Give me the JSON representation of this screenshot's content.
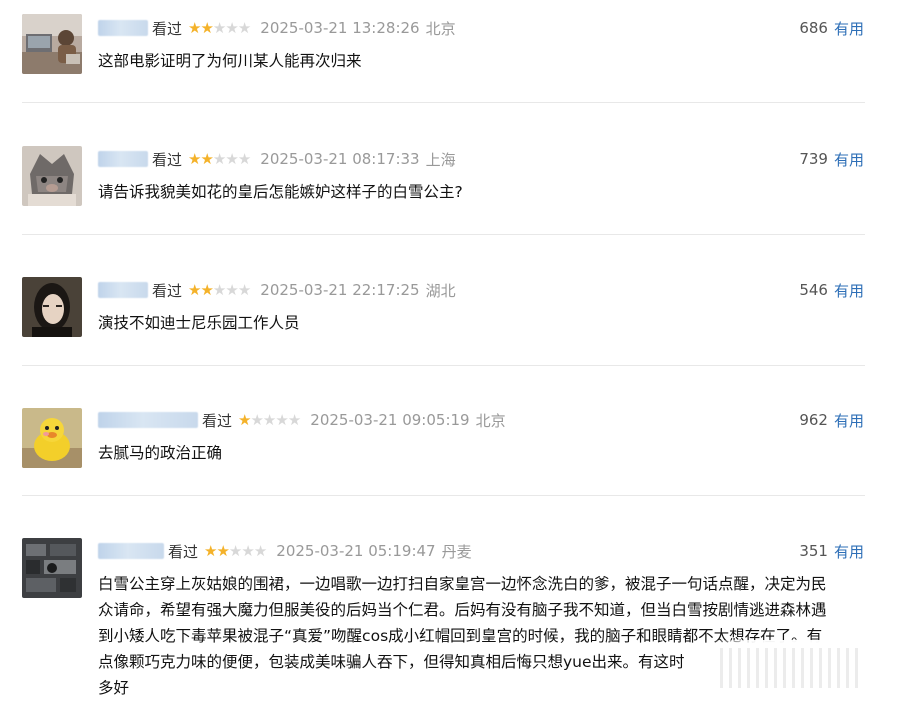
{
  "comments": [
    {
      "watched": "看过",
      "time": "2025-03-21 13:28:26",
      "location": "北京",
      "votes": "686",
      "useful": "有用",
      "text": "这部电影证明了为何川某人能再次归来",
      "rating": 2,
      "avatar": "person-at-desk-avatar"
    },
    {
      "watched": "看过",
      "time": "2025-03-21 08:17:33",
      "location": "上海",
      "votes": "739",
      "useful": "有用",
      "text": "请告诉我貌美如花的皇后怎能嫉妒这样子的白雪公主?",
      "rating": 2,
      "avatar": "boar-mask-avatar"
    },
    {
      "watched": "看过",
      "time": "2025-03-21 22:17:25",
      "location": "湖北",
      "votes": "546",
      "useful": "有用",
      "text": "演技不如迪士尼乐园工作人员",
      "rating": 2,
      "avatar": "dark-haired-man-avatar"
    },
    {
      "watched": "看过",
      "time": "2025-03-21 09:05:19",
      "location": "北京",
      "votes": "962",
      "useful": "有用",
      "text": "去腻马的政治正确",
      "rating": 1,
      "avatar": "yellow-duck-avatar"
    },
    {
      "watched": "看过",
      "time": "2025-03-21 05:19:47",
      "location": "丹麦",
      "votes": "351",
      "useful": "有用",
      "text_lines": [
        "白雪公主穿上灰姑娘的围裙，一边唱歌一边打扫自家皇宫一边怀念洗白的爹，被混子一句话点醒，决定为民",
        "众请命，希望有强大魔力但服美役的后妈当个仁君。后妈有没有脑子我不知道，但当白雪按剧情逃进森林遇",
        "到小矮人吃下毒苹果被混子“真爱”吻醒cos成小红帽回到皇宫的时候，我的脑子和眼睛都不太想存在了。有",
        "点像颗巧克力味的便便，包装成美味骗人吞下，但得知真相后悔只想yue出来。有这时",
        "多好"
      ],
      "rating": 2,
      "avatar": "stone-wall-avatar"
    }
  ]
}
